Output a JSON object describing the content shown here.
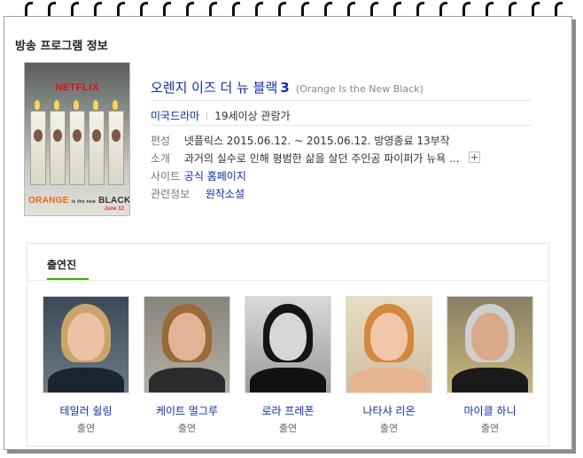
{
  "section_title": "방송 프로그램 정보",
  "poster": {
    "logo": "NETFLIX",
    "title_pre": "ORANGE",
    "title_mid": "is the new",
    "title_post": "BLACK",
    "date": "June 12"
  },
  "program": {
    "title": "오렌지 이즈 더 뉴 블랙",
    "season": "3",
    "original_title": "(Orange Is the New Black)",
    "genre": "미국드라마",
    "rating": "19세이상 관람가"
  },
  "info": {
    "schedule_label": "편성",
    "schedule_value": "넷플릭스 2015.06.12. ~ 2015.06.12. 방영종료 13부작",
    "summary_label": "소개",
    "summary_value": "과거의 실수로 인해 평범한 삶을 살던 주인공 파이퍼가 뉴욕 ...",
    "site_label": "사이트",
    "site_value": "공식 홈페이지",
    "related_label": "관련정보",
    "related_value": "원작소설"
  },
  "cast": {
    "tab_label": "출연진",
    "members": [
      {
        "name": "테일러 쉴링",
        "role": "출연"
      },
      {
        "name": "케이트 멀그루",
        "role": "출연"
      },
      {
        "name": "로라 프레폰",
        "role": "출연"
      },
      {
        "name": "나타샤 리온",
        "role": "출연"
      },
      {
        "name": "마이클 하니",
        "role": "출연"
      }
    ]
  },
  "colors": {
    "link": "#0d2eae",
    "tab_underline": "#2db400",
    "netflix_red": "#e50914"
  }
}
